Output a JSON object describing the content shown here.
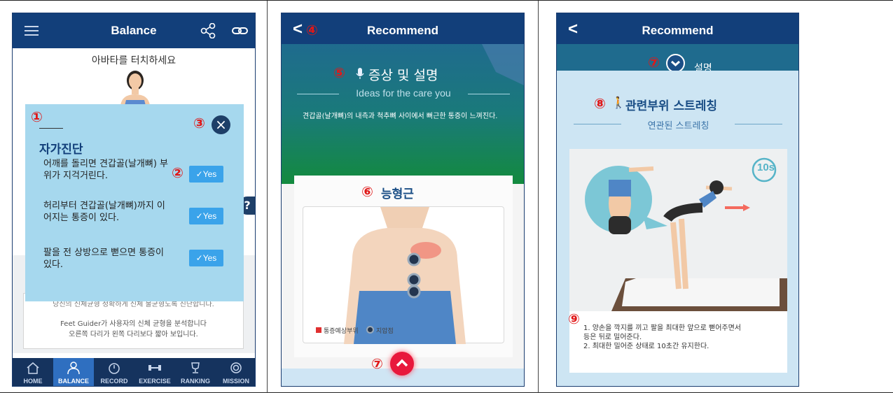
{
  "panel1": {
    "header_title": "Balance",
    "touch_prompt": "아바타를 터치하세요",
    "modal": {
      "title": "자가진단",
      "items": [
        {
          "text": "어깨를 돌리면 견갑골(날개뼈) 부위가 지걱거린다.",
          "button": "Yes"
        },
        {
          "text": "허리부터 견갑골(날개뼈)까지 이어지는 통증이 있다.",
          "button": "Yes"
        },
        {
          "text": "팔을 전 상방으로 뻗으면 통증이 있다.",
          "button": "Yes"
        }
      ]
    },
    "bg_text_partial": "당신의 신체균형 정확하게 신체 불균형도록 진단합니다.",
    "bg_text_line2": "Feet Guider가 사용자의 신체 균형을 분석합니다",
    "bg_text_line3": "오른쪽 다리가 왼쪽 다리보다 짧아 보입니다.",
    "side_tab_glyph": "?",
    "nav": [
      "HOME",
      "BALANCE",
      "RECORD",
      "EXERCISE",
      "RANKING",
      "MISSION"
    ],
    "active_nav": "BALANCE"
  },
  "panel2": {
    "back_glyph": "<",
    "header_title": "Recommend",
    "section_title": "증상 및 설명",
    "section_sub": "Ideas for the care you",
    "description": "견갑골(날개뼈)의 내측과 척추뼈 사이에서 뻐근한 통증이 느껴진다.",
    "muscle_title": "능형근",
    "legend": [
      {
        "label": "통증예상부위",
        "color": "#e03030"
      },
      {
        "label": "지압점",
        "color": "#26364c"
      }
    ]
  },
  "panel3": {
    "back_glyph": "<",
    "header_title": "Recommend",
    "partial_heading": "설명",
    "stretch_title": "관련부위 스트레칭",
    "stretch_sub": "연관된 스트레칭",
    "timer_label": "10s",
    "instructions": [
      "1. 양손을 깍지를 끼고 팔을 최대한 앞으로 뻗어주면서",
      "등은 뒤로 밀어준다.",
      "2. 최대한 밀어준 상태로 10초간 유지한다."
    ]
  },
  "badges": [
    "①",
    "②",
    "③",
    "④",
    "⑤",
    "⑥",
    "⑦",
    "⑧",
    "⑨"
  ],
  "colors": {
    "header": "#123f7a",
    "accent": "#3aa3ea",
    "badge": "#e01818",
    "modal": "#a6d8ee"
  }
}
